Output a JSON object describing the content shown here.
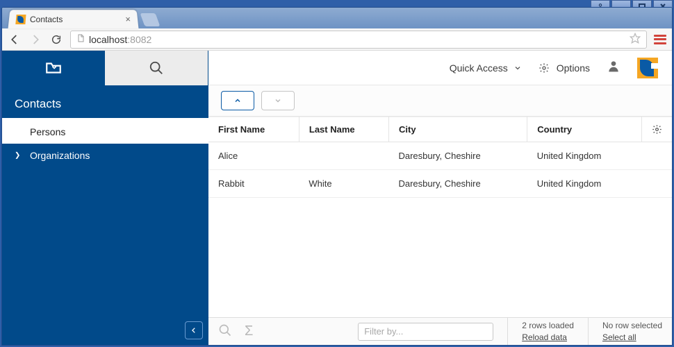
{
  "browser": {
    "tab_title": "Contacts",
    "url_host": "localhost",
    "url_port": ":8082"
  },
  "sidebar": {
    "title": "Contacts",
    "items": [
      {
        "label": "Persons",
        "active": true
      },
      {
        "label": "Organizations",
        "active": false,
        "expandable": true
      }
    ]
  },
  "topbar": {
    "quick_access": "Quick Access",
    "options": "Options"
  },
  "table": {
    "columns": [
      "First Name",
      "Last Name",
      "City",
      "Country"
    ],
    "rows": [
      {
        "first_name": "Alice",
        "last_name": "",
        "city": "Daresbury, Cheshire",
        "country": "United Kingdom"
      },
      {
        "first_name": "Rabbit",
        "last_name": "White",
        "city": "Daresbury, Cheshire",
        "country": "United Kingdom"
      }
    ]
  },
  "statusbar": {
    "filter_placeholder": "Filter by...",
    "rows_loaded": "2 rows loaded",
    "reload": "Reload data",
    "selection": "No row selected",
    "select_all": "Select all"
  }
}
